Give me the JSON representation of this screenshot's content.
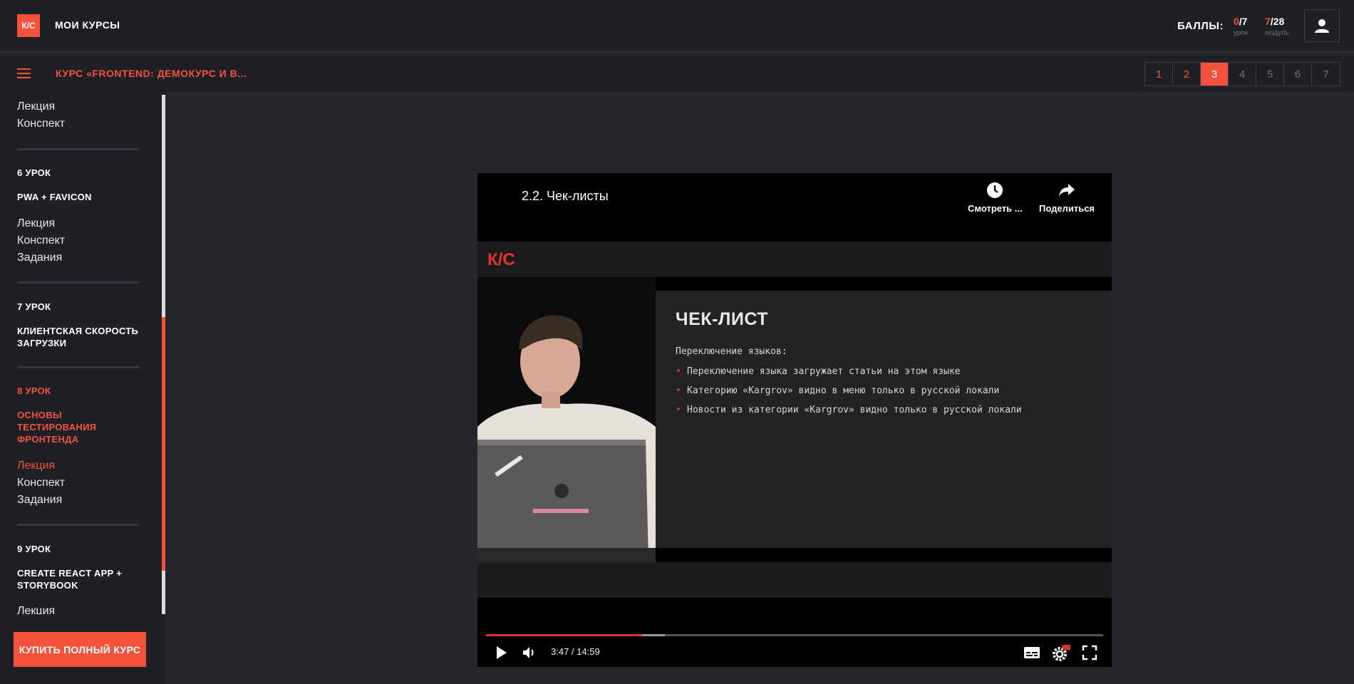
{
  "header": {
    "logo": "К/С",
    "my_courses": "МОИ КУРСЫ",
    "score_label": "БАЛЛЫ:",
    "lesson_score": {
      "earned": "0",
      "total": "/7",
      "caption": "урок"
    },
    "module_score": {
      "earned": "7",
      "total": "/28",
      "caption": "модуль"
    }
  },
  "course_bar": {
    "title": "КУРС «FRONTEND: ДЕМОКУРС И В...",
    "pages": [
      "1",
      "2",
      "3",
      "4",
      "5",
      "6",
      "7"
    ],
    "active_page": "3"
  },
  "sidebar": {
    "prev_links": [
      "Лекция",
      "Конспект"
    ],
    "lesson6": {
      "head": "6 УРОК",
      "title": "PWA + FAVICON",
      "links": [
        "Лекция",
        "Конспект",
        "Задания"
      ]
    },
    "lesson7": {
      "head": "7 УРОК",
      "title": "КЛИЕНТСКАЯ СКОРОСТЬ ЗАГРУЗКИ"
    },
    "lesson8": {
      "head": "8 УРОК",
      "title": "ОСНОВЫ ТЕСТИРОВАНИЯ ФРОНТЕНДА",
      "links": [
        "Лекция",
        "Конспект",
        "Задания"
      ]
    },
    "lesson9": {
      "head": "9 УРОК",
      "title": "CREATE REACT APP + STORYBOOK",
      "links": [
        "Лекция"
      ]
    },
    "buy_button": "КУПИТЬ ПОЛНЫЙ КУРС"
  },
  "video": {
    "title": "2.2. Чек-листы",
    "watch_later": "Смотреть ...",
    "share": "Поделиться",
    "frame_logo": "К/С",
    "slide": {
      "title": "ЧЕК-ЛИСТ",
      "subtitle": "Переключение языков:",
      "bullets": [
        "Переключение языка загружает статьи на этом языке",
        "Категорию «Kargrov» видно в меню только в русской локали",
        "Новости из категории «Kargrov» видно только в русской локали"
      ]
    },
    "time": "3:47 / 14:59",
    "progress": 0.2525,
    "buffered": 0.29
  },
  "colors": {
    "accent": "#f4523b",
    "bg": "#25272c",
    "panel": "#1e2026"
  }
}
